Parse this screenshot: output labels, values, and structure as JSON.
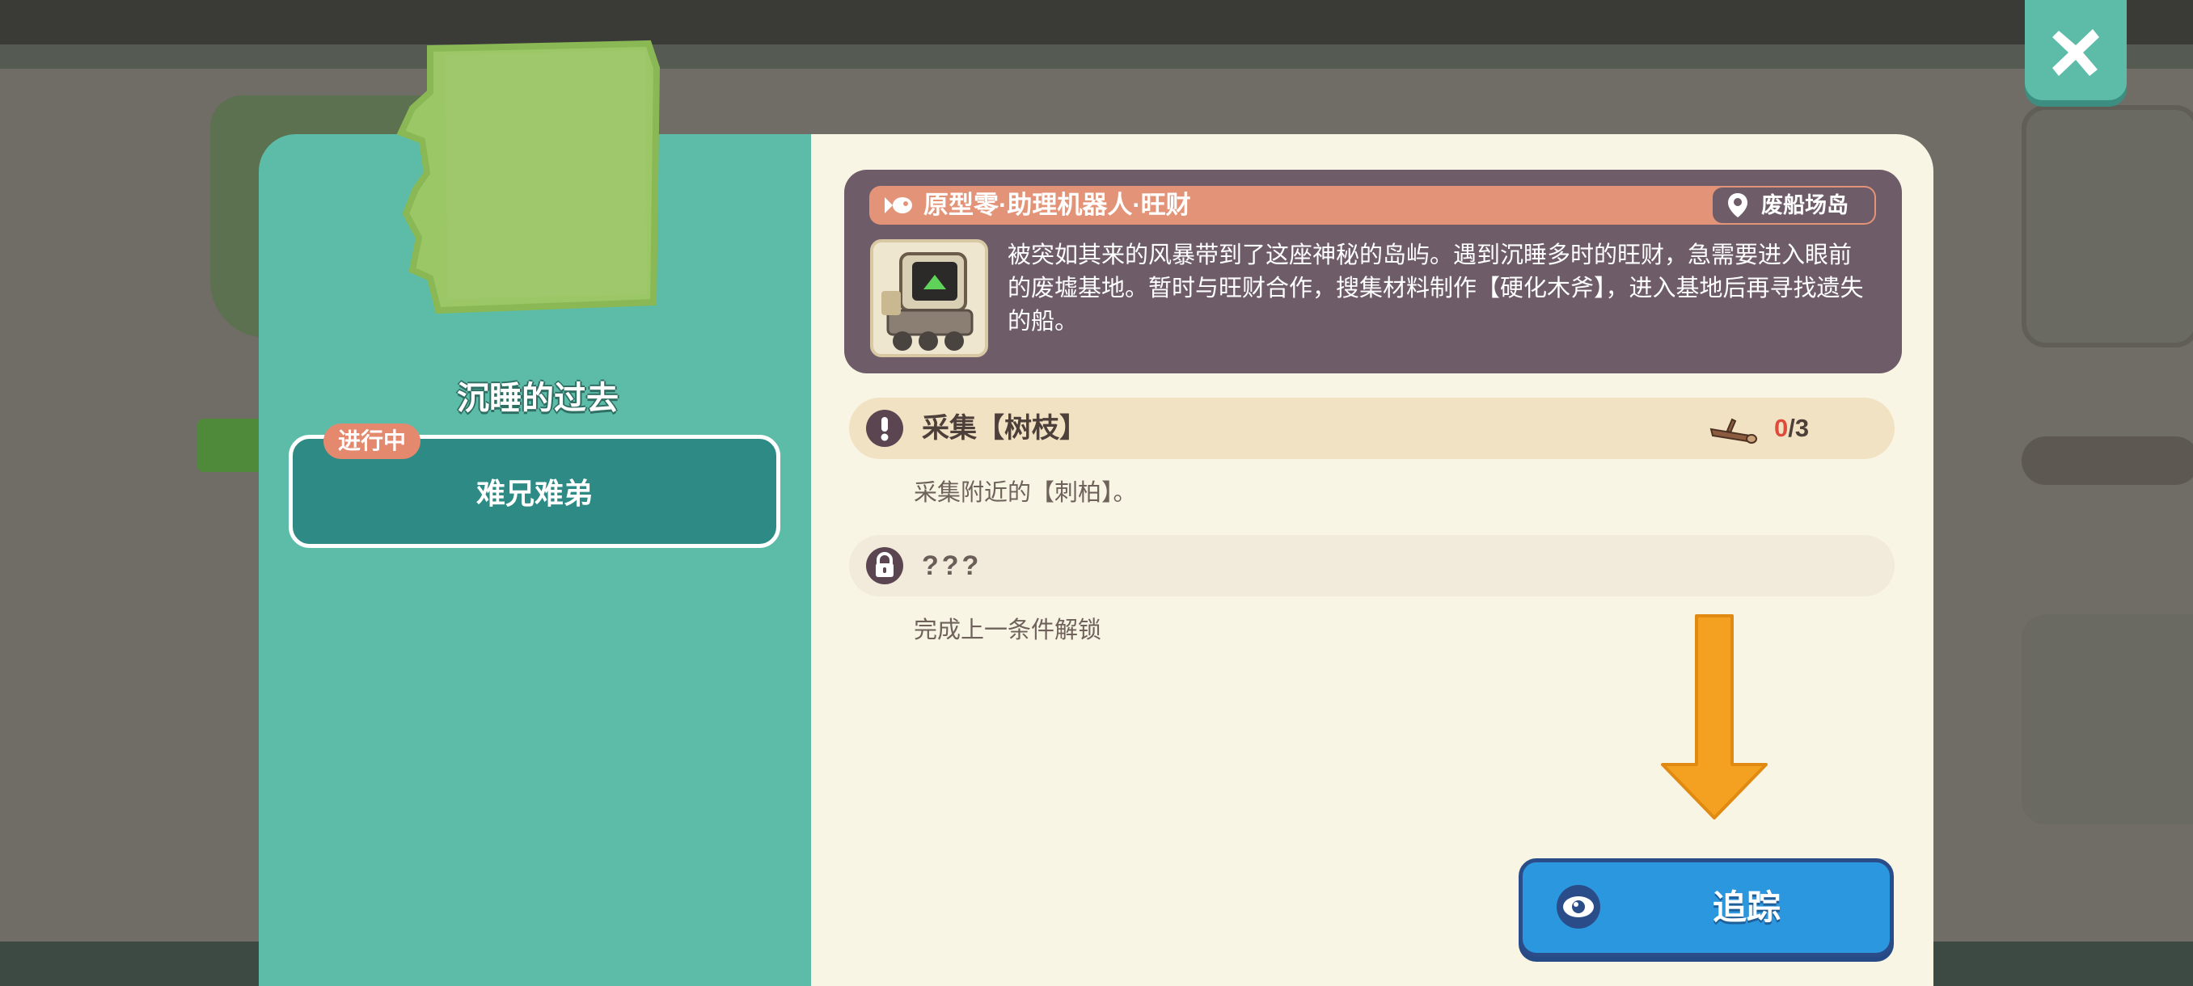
{
  "quest": {
    "title": "沉睡的过去",
    "status_badge": "进行中",
    "current_item": "难兄难弟"
  },
  "npc": {
    "name": "原型零·助理机器人·旺财",
    "location": "废船场岛",
    "description": "被突如其来的风暴带到了这座神秘的岛屿。遇到沉睡多时的旺财，急需要进入眼前的废墟基地。暂时与旺财合作，搜集材料制作【硬化木斧】，进入基地后再寻找遗失的船。"
  },
  "objectives": [
    {
      "title": "采集【树枝】",
      "description": "采集附近的【刺柏】。",
      "icon": "exclamation-icon",
      "progress_current": "0",
      "progress_total": "/3",
      "item_icon": "branch-icon"
    },
    {
      "title": "???",
      "description": "完成上一条件解锁",
      "icon": "lock-icon"
    }
  ],
  "track_button": {
    "label": "追踪",
    "icon": "eye-icon"
  },
  "colors": {
    "panel_left": "#5cbca8",
    "panel_right": "#f8f5e4",
    "npc_card": "#6e5c68",
    "npc_header": "#e39478",
    "track_button": "#2a97df",
    "progress_current": "#e04b3c",
    "arrow": "#f4a121"
  }
}
